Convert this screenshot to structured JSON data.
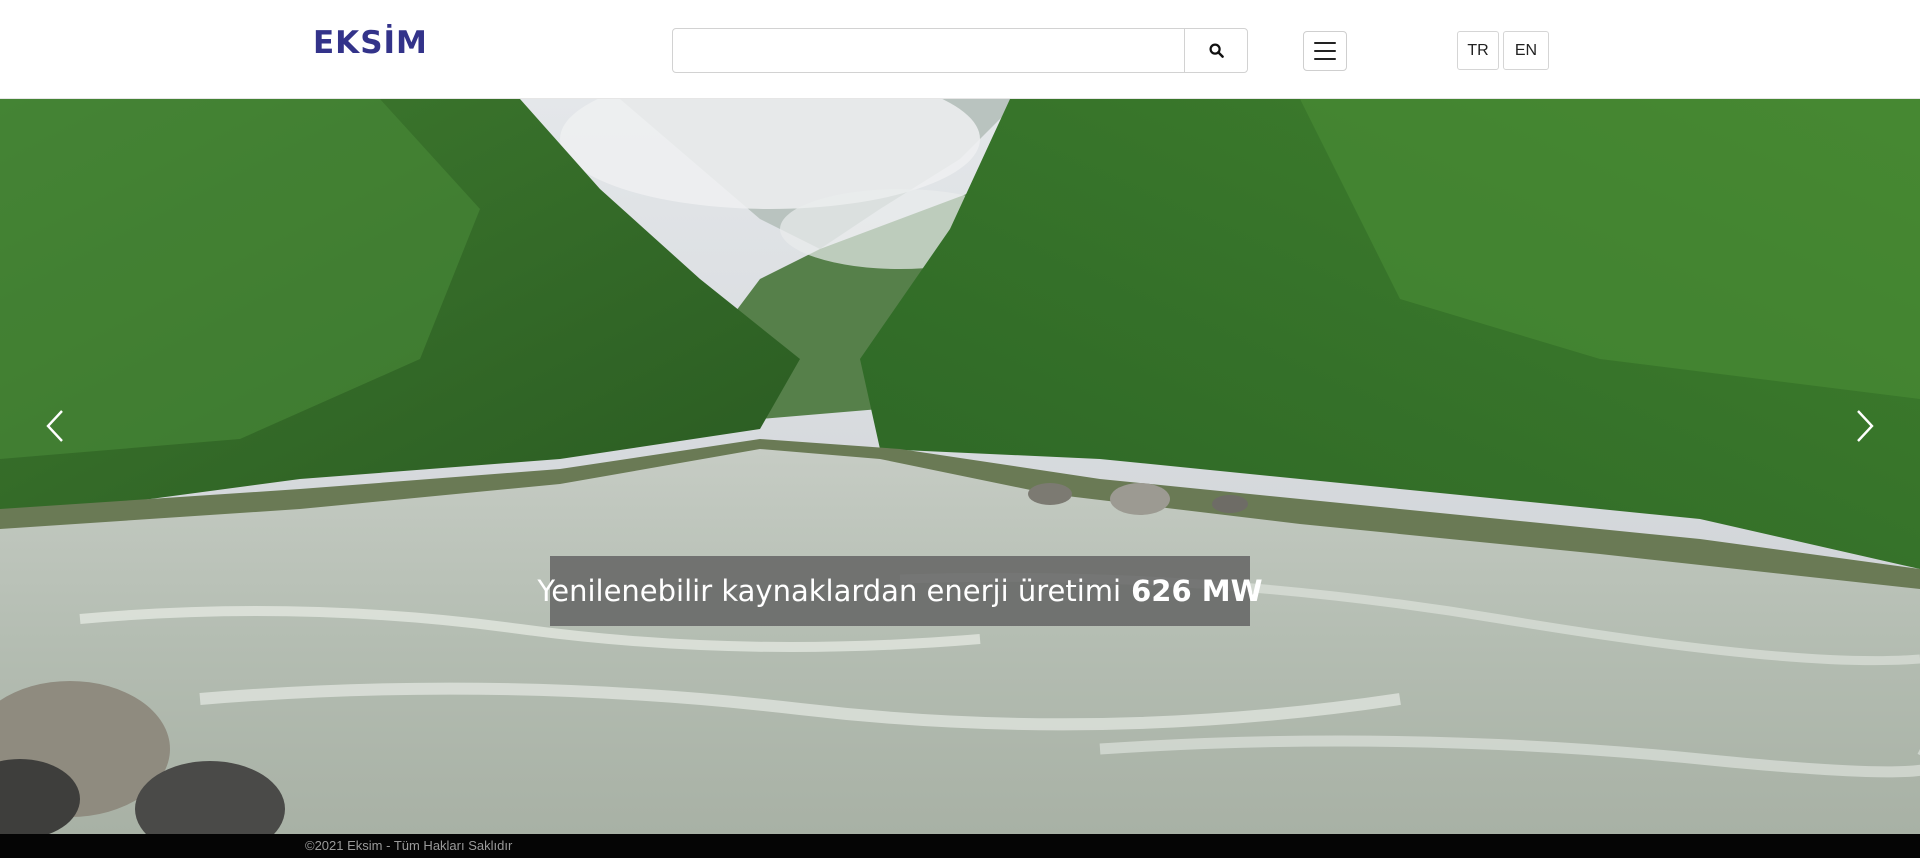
{
  "header": {
    "logo_text": "EKSİM",
    "search": {
      "value": "",
      "placeholder": ""
    },
    "search_button_icon": "search-icon",
    "menu_icon": "hamburger-menu-icon",
    "languages": [
      "TR",
      "EN"
    ]
  },
  "hero": {
    "caption_text": "Yenilenebilir kaynaklardan enerji üretimi",
    "caption_value": "626 MW",
    "prev_icon": "chevron-left-icon",
    "next_icon": "chevron-right-icon"
  },
  "footer": {
    "copyright": "©2021 Eksim - Tüm Hakları Saklıdır"
  },
  "colors": {
    "brand": "#33338a",
    "caption_bg": "#606060",
    "footer_bg": "#050505"
  }
}
